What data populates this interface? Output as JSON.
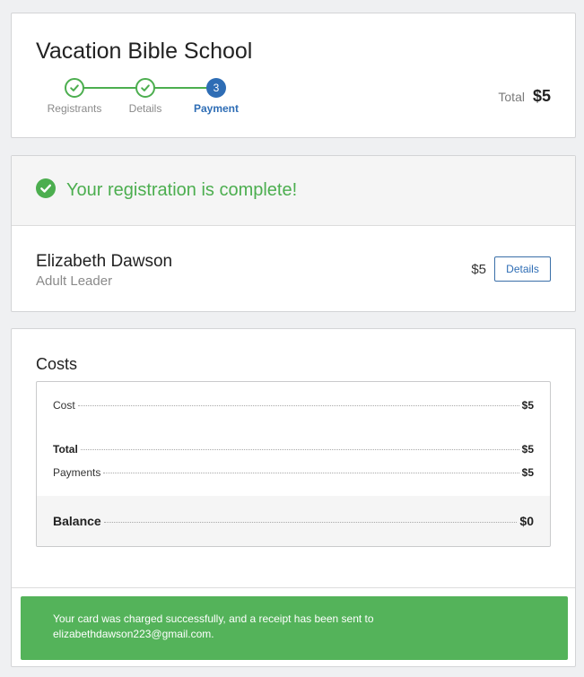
{
  "event": {
    "title": "Vacation Bible School",
    "total_label": "Total",
    "total_value": "$5"
  },
  "steps": [
    {
      "label": "Registrants",
      "state": "done",
      "icon": "check-icon"
    },
    {
      "label": "Details",
      "state": "done",
      "icon": "check-icon"
    },
    {
      "label": "Payment",
      "state": "active",
      "number": "3"
    }
  ],
  "confirmation": {
    "message": "Your registration is complete!",
    "icon": "check-circle-icon"
  },
  "registrant": {
    "name": "Elizabeth Dawson",
    "role": "Adult Leader",
    "amount": "$5",
    "details_label": "Details"
  },
  "costs": {
    "title": "Costs",
    "lines": [
      {
        "label": "Cost",
        "amount": "$5"
      },
      {
        "label": "Total",
        "amount": "$5"
      },
      {
        "label": "Payments",
        "amount": "$5"
      },
      {
        "label": "Balance",
        "amount": "$0"
      }
    ]
  },
  "receipt": {
    "line1": "Your card was charged successfully, and a receipt has been sent to",
    "line2": "elizabethdawson223@gmail.com."
  },
  "colors": {
    "accent_green": "#4cae4f",
    "alert_green": "#54b35a",
    "active_blue": "#2e6db5"
  }
}
